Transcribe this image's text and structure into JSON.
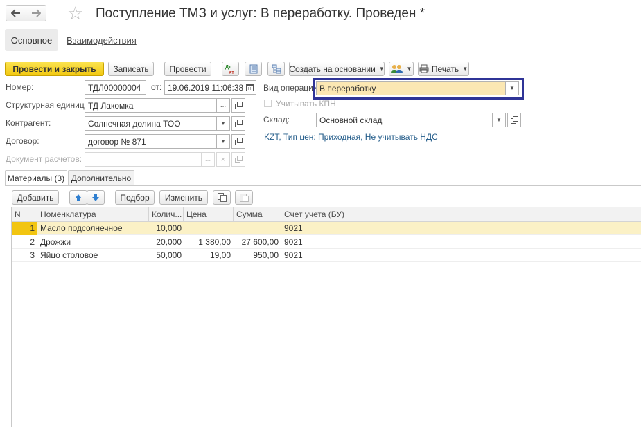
{
  "header": {
    "title": "Поступление ТМЗ и услуг: В переработку. Проведен *",
    "tabs": {
      "main": "Основное",
      "interactions": "Взаимодействия"
    }
  },
  "toolbar": {
    "post_close": "Провести и закрыть",
    "save": "Записать",
    "post": "Провести",
    "create_basis": "Создать на основании",
    "print": "Печать"
  },
  "form": {
    "number": {
      "label": "Номер:",
      "value": "ТДЛ00000004"
    },
    "date": {
      "label": "от:",
      "value": "19.06.2019 11:06:38"
    },
    "unit": {
      "label": "Структурная единица:",
      "value": "ТД Лакомка"
    },
    "counterparty": {
      "label": "Контрагент:",
      "value": "Солнечная долина ТОО"
    },
    "contract": {
      "label": "Договор:",
      "value": "договор № 871"
    },
    "settlement_doc": {
      "label": "Документ расчетов:",
      "value": ""
    },
    "operation_type": {
      "label": "Вид операции:",
      "value": "В переработку"
    },
    "kpn": {
      "label": "Учитывать КПН"
    },
    "warehouse": {
      "label": "Склад:",
      "value": "Основной склад"
    },
    "price_info": "KZT, Тип цен: Приходная, Не учитывать НДС"
  },
  "tabs": [
    {
      "label": "Материалы (3)"
    },
    {
      "label": "Дополнительно"
    }
  ],
  "table_toolbar": {
    "add": "Добавить",
    "pick": "Подбор",
    "change": "Изменить"
  },
  "table": {
    "columns": [
      "N",
      "Номенклатура",
      "Колич...",
      "Цена",
      "Сумма",
      "Счет учета (БУ)"
    ],
    "rows": [
      {
        "n": "1",
        "name": "Масло подсолнечное",
        "qty": "10,000",
        "price": "",
        "sum": "",
        "account": "9021"
      },
      {
        "n": "2",
        "name": "Дрожжи",
        "qty": "20,000",
        "price": "1 380,00",
        "sum": "27 600,00",
        "account": "9021"
      },
      {
        "n": "3",
        "name": "Яйцо столовое",
        "qty": "50,000",
        "price": "19,00",
        "sum": "950,00",
        "account": "9021"
      }
    ]
  },
  "colors": {
    "accent": "#f2c811",
    "focus": "#2f3497",
    "selected_row": "#fbf1c6",
    "link": "#235c8a"
  }
}
